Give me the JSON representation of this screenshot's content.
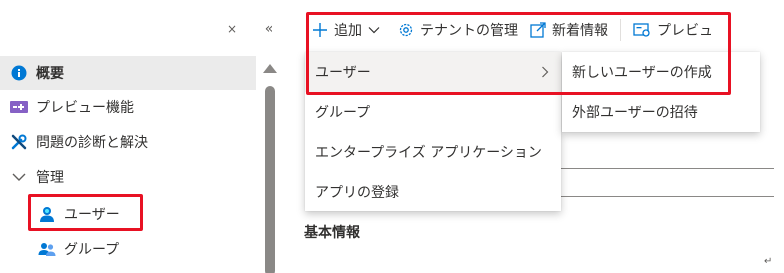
{
  "nav": {
    "close_icon": "×",
    "collapse_icon": "«",
    "items": [
      {
        "label": "概要",
        "icon": "info-icon"
      },
      {
        "label": "プレビュー機能",
        "icon": "preview-features-icon"
      },
      {
        "label": "問題の診断と解決",
        "icon": "wrench-icon"
      },
      {
        "label": "管理",
        "icon": "chevron-down-icon"
      },
      {
        "label": "ユーザー",
        "icon": "user-icon"
      },
      {
        "label": "グループ",
        "icon": "group-icon"
      }
    ]
  },
  "toolbar": {
    "add_label": "追加",
    "tenant_label": "テナントの管理",
    "whats_new_label": "新着情報",
    "preview_label": "プレビュ"
  },
  "add_menu": {
    "items": [
      "ユーザー",
      "グループ",
      "エンタープライズ アプリケーション",
      "アプリの登録"
    ]
  },
  "user_submenu": {
    "items": [
      "新しいユーザーの作成",
      "外部ユーザーの招待"
    ]
  },
  "main": {
    "section_title": "基本情報",
    "return_mark": "↵"
  },
  "colors": {
    "accent": "#0078d4",
    "annotation": "#e81123",
    "selected_bg": "#ebebeb"
  }
}
